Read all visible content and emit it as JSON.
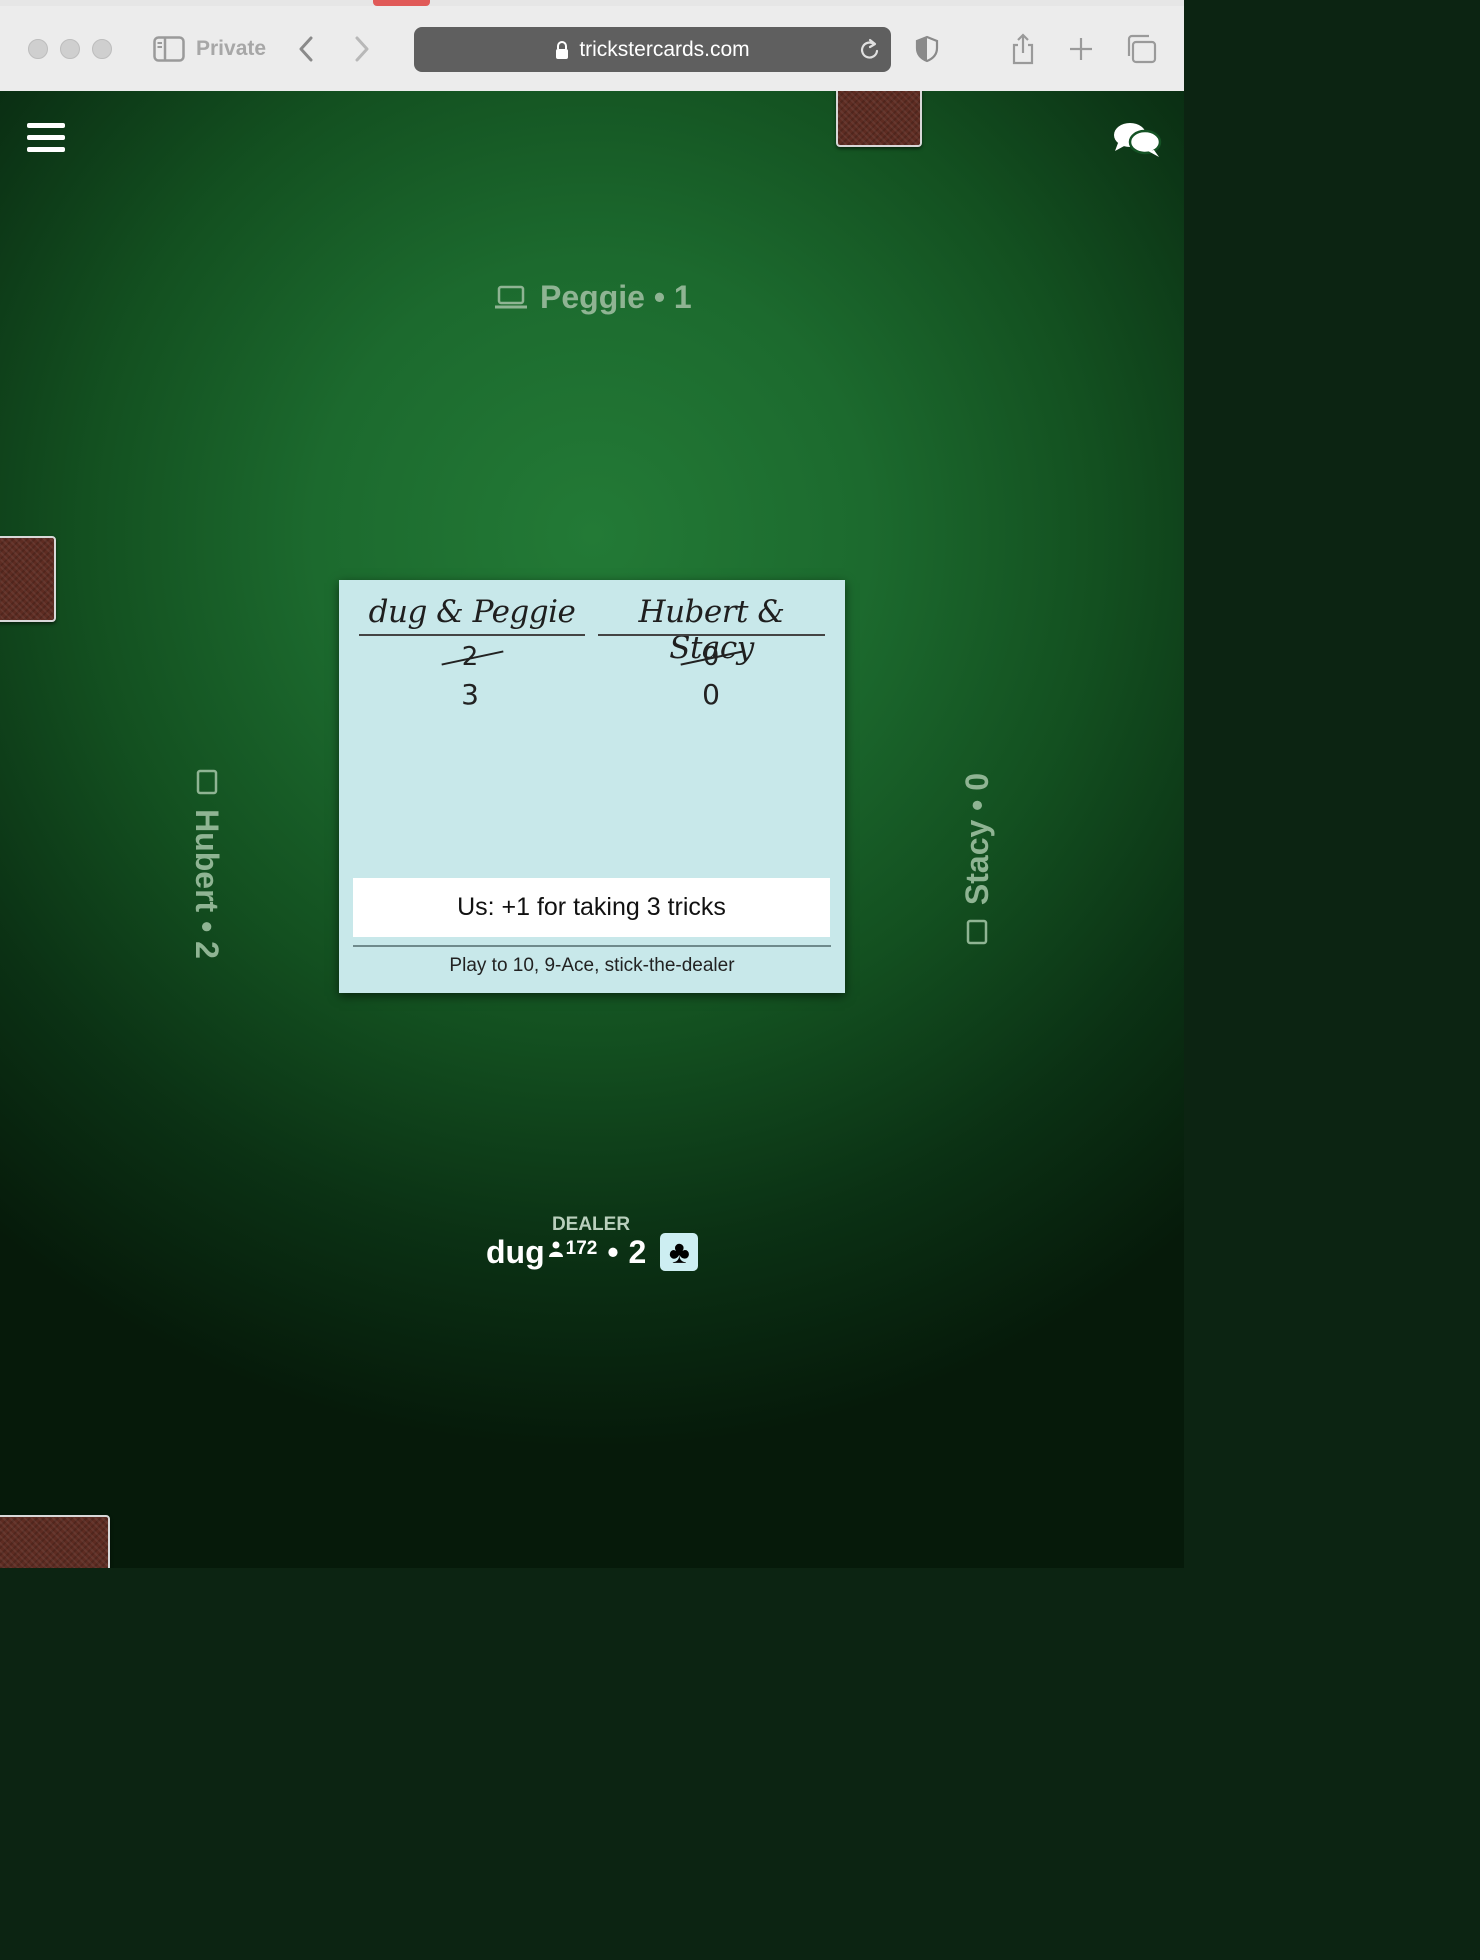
{
  "browser": {
    "mode_label": "Private",
    "url": "trickstercards.com"
  },
  "players": {
    "top": {
      "name_score": "Peggie • 1"
    },
    "left": {
      "name_score": "Hubert • 2"
    },
    "right": {
      "name_score": "Stacy • 0"
    },
    "me": {
      "dealer_label": "DEALER",
      "name": "dug",
      "rating": "172",
      "score_sep": "•",
      "score": "2",
      "trump_suit": "♣"
    }
  },
  "scorecard": {
    "teams": [
      {
        "name": "dug & Peggie",
        "previous_score": "2",
        "current_score": "3"
      },
      {
        "name": "Hubert & Stacy",
        "previous_score": "0",
        "current_score": "0"
      }
    ],
    "result_message": "Us: +1 for taking 3 tricks",
    "rules": "Play to 10, 9-Ace, stick-the-dealer"
  },
  "colors": {
    "felt": "#1c6a2e",
    "scorecard_bg": "#c8e8ea",
    "card_back": "#5e2c22"
  },
  "icons": [
    "menu-icon",
    "chat-icon",
    "laptop-icon",
    "tablet-icon",
    "person-icon",
    "club-suit-icon"
  ]
}
